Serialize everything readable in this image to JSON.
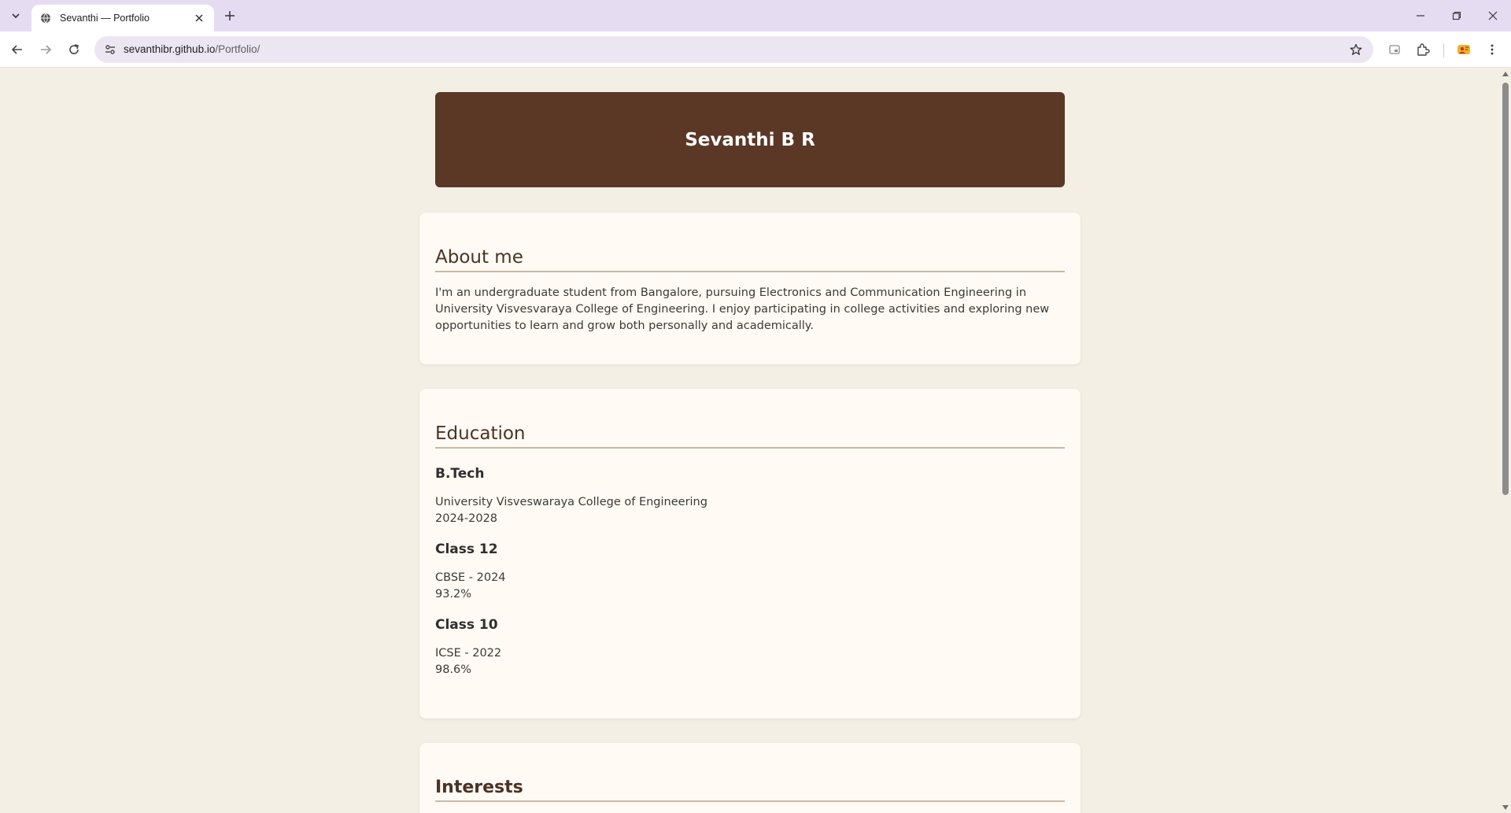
{
  "browser": {
    "tab_title": "Sevanthi — Portfolio",
    "url_host": "sevanthibr.github.io",
    "url_path": "/Portfolio/"
  },
  "page": {
    "name": "Sevanthi B R",
    "about": {
      "heading": "About me",
      "lines": [
        "I'm an undergraduate student from Bangalore, pursuing Electronics and Communication Engineering in",
        "University Visvesvaraya College of Engineering. I enjoy participating in college activities and exploring new",
        "opportunities to learn and grow both personally and academically."
      ]
    },
    "education": {
      "heading": "Education",
      "items": [
        {
          "title": "B.Tech",
          "line1": "University Visveswaraya College of Engineering",
          "line2": "2024-2028"
        },
        {
          "title": "Class 12",
          "line1": "CBSE - 2024",
          "line2": "93.2%"
        },
        {
          "title": "Class 10",
          "line1": "ICSE - 2022",
          "line2": "98.6%"
        }
      ]
    },
    "interests": {
      "heading": "Interests"
    }
  },
  "colors": {
    "page_bg": "#f4efe4",
    "banner_bg": "#5b3726",
    "card_bg": "#fffaf3",
    "tabstrip_bg": "#e6dcf2"
  },
  "icons": [
    "tab-search-icon",
    "globe-icon",
    "close-icon",
    "plus-icon",
    "minimize-icon",
    "restore-icon",
    "back-arrow-icon",
    "forward-arrow-icon",
    "reload-icon",
    "site-info-icon",
    "star-icon",
    "tab-groups-icon",
    "extensions-icon",
    "profile-icon",
    "kebab-menu-icon"
  ]
}
